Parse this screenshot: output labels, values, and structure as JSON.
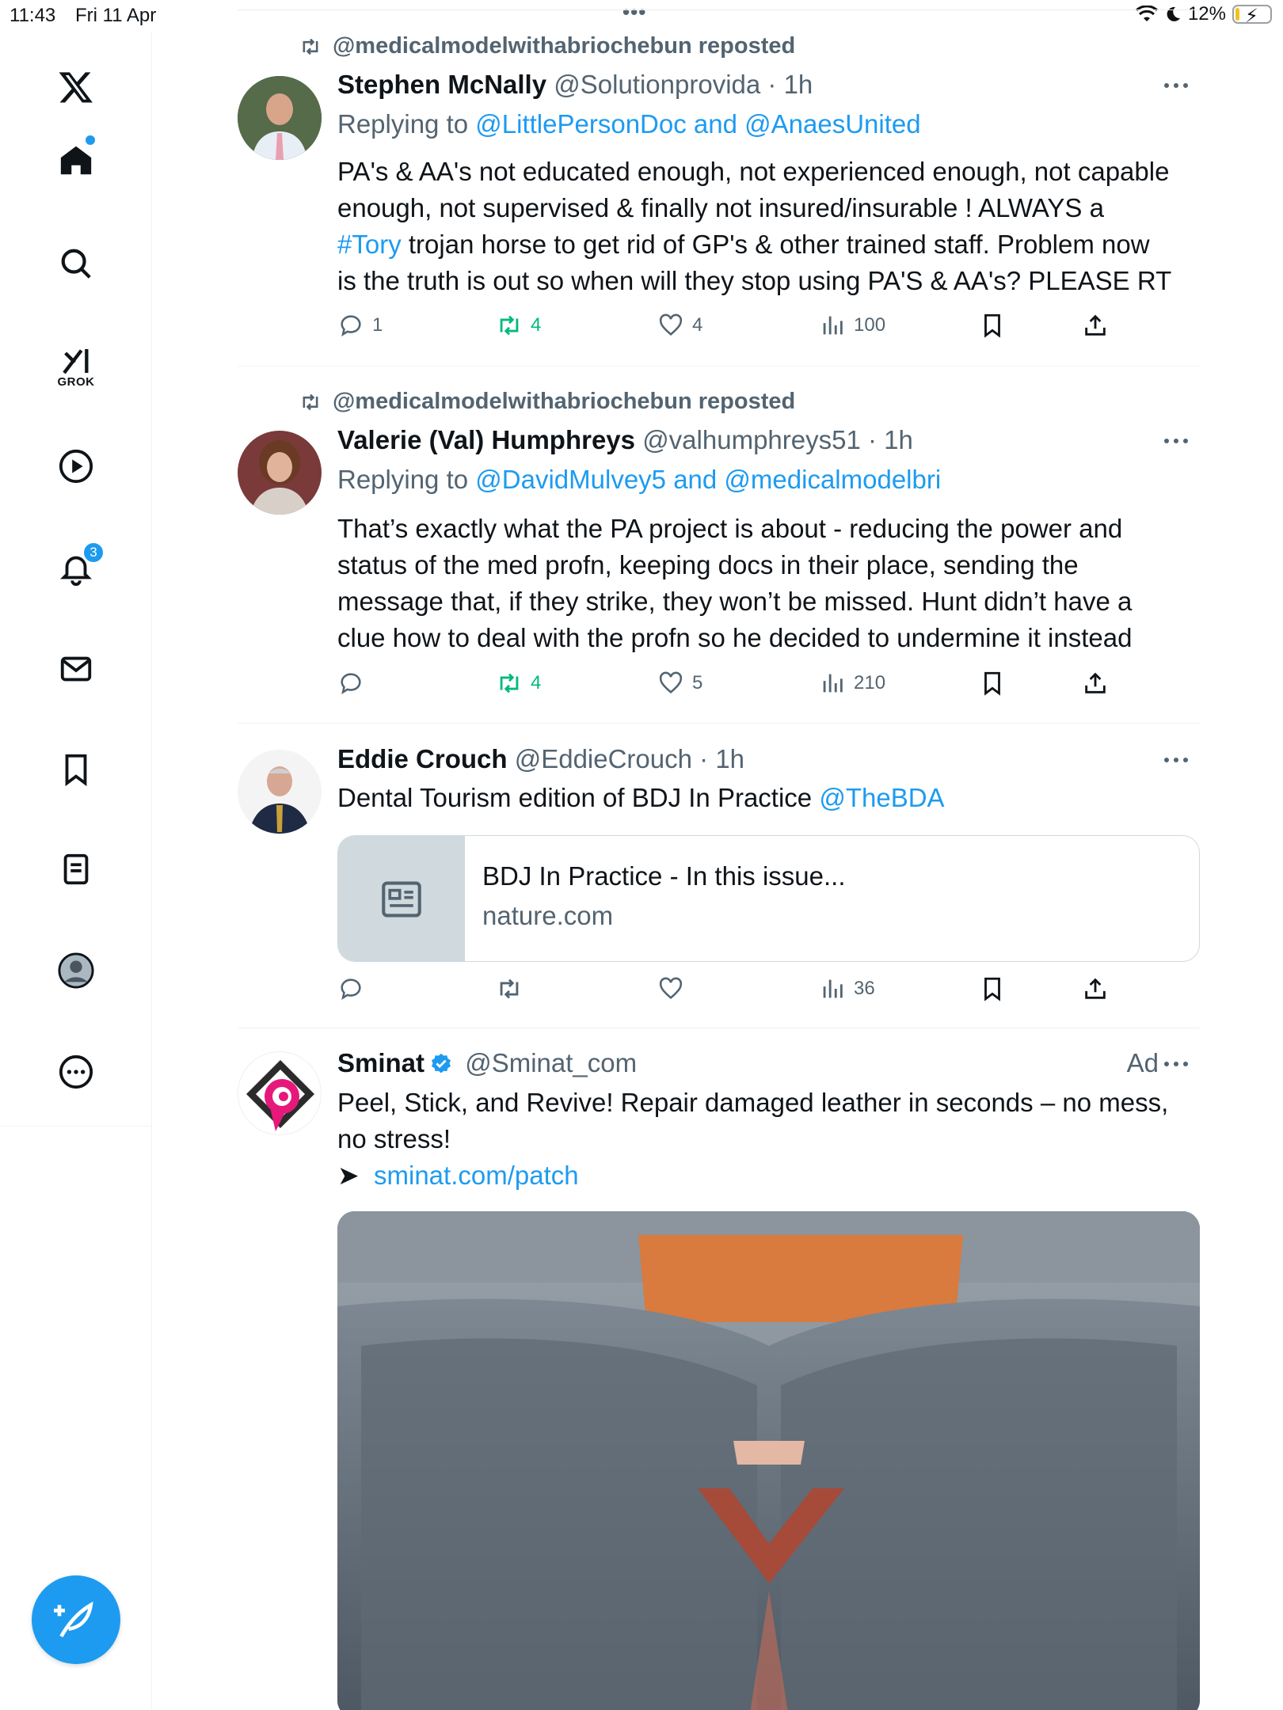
{
  "status_bar": {
    "time": "11:43",
    "date": "Fri 11 Apr",
    "battery": "12%",
    "battery_level": 0.12
  },
  "sidebar": {
    "grok_label": "GROK",
    "notification_count": "3"
  },
  "tweets": [
    {
      "repost_by": "@medicalmodelwithabriochebun reposted",
      "name": "Stephen McNally",
      "handle": "@Solutionprovida",
      "time": "· 1h",
      "replying_prefix": "Replying to",
      "replying_mentions": "@LittlePersonDoc and @AnaesUnited",
      "text_lines": [
        "PA's & AA's not educated enough, not experienced enough, not capable",
        "enough, not supervised & finally not insured/insurable ! ALWAYS a",
        "trojan horse to get rid of GP's & other trained staff. Problem now",
        "is the truth is out so when will they stop using PA'S & AA's? PLEASE RT"
      ],
      "hashtag": "#Tory",
      "replies": "1",
      "reposts": "4",
      "likes": "4",
      "views": "100"
    },
    {
      "repost_by": "@medicalmodelwithabriochebun reposted",
      "name": "Valerie (Val) Humphreys",
      "handle": "@valhumphreys51",
      "time": "· 1h",
      "replying_prefix": "Replying to",
      "replying_mentions": "@DavidMulvey5 and @medicalmodelbri",
      "text_lines": [
        "That’s exactly what the PA project is about - reducing the power and",
        "status of the med profn, keeping docs in their place, sending the",
        "message that, if they strike, they won’t be missed. Hunt didn’t have a",
        "clue how to deal with the profn so he decided to undermine it instead"
      ],
      "replies": "",
      "reposts": "4",
      "likes": "5",
      "views": "210"
    },
    {
      "name": "Eddie Crouch",
      "handle": "@EddieCrouch",
      "time": "· 1h",
      "text": "Dental Tourism edition of BDJ In Practice",
      "mention": "@TheBDA",
      "card_title": "BDJ In Practice - In this issue...",
      "card_domain": "nature.com",
      "views": "36"
    },
    {
      "name": "Sminat",
      "handle": "@Sminat_com",
      "ad_label": "Ad",
      "text_lines": [
        "Peel, Stick, and Revive! Repair damaged leather in seconds – no mess,",
        "no stress!"
      ],
      "arrow": "➤",
      "link": "sminat.com/patch"
    }
  ],
  "colors": {
    "accent": "#1d9bf0",
    "repost_green": "#00ba7c",
    "secondary_text": "#536471",
    "primary_text": "#0f1419"
  }
}
